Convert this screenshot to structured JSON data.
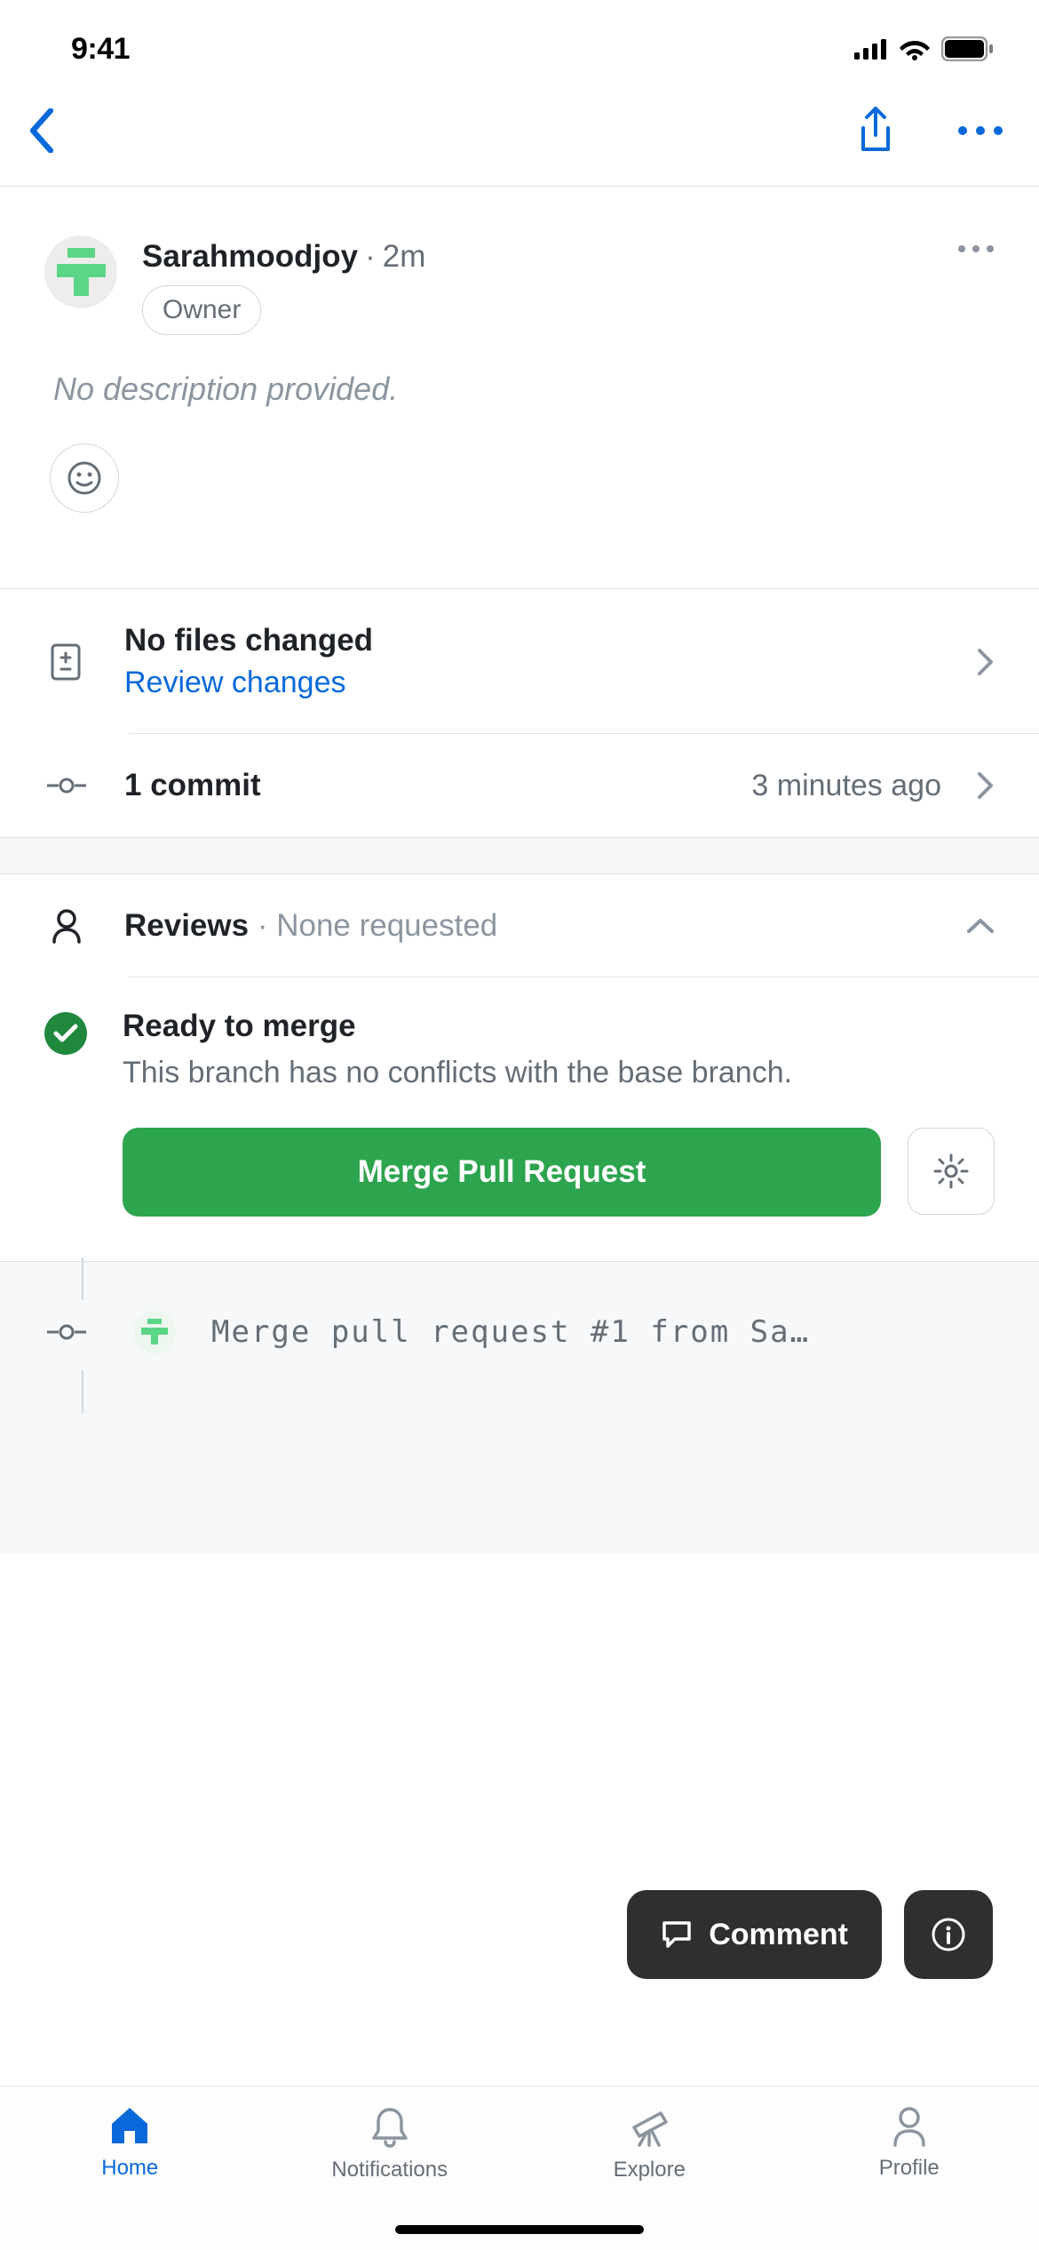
{
  "status_bar": {
    "time": "9:41"
  },
  "author": {
    "name": "Sarahmoodjoy",
    "separator": "·",
    "time_ago": "2m",
    "badge": "Owner"
  },
  "description_placeholder": "No description provided.",
  "files": {
    "title": "No files changed",
    "link": "Review changes"
  },
  "commits": {
    "count_label": "1 commit",
    "time": "3 minutes ago"
  },
  "reviews": {
    "label": "Reviews",
    "separator": " · ",
    "status": "None requested"
  },
  "merge": {
    "title": "Ready to merge",
    "description": "This branch has no conflicts with the base branch.",
    "button": "Merge Pull Request"
  },
  "commit_log": {
    "message": "Merge pull request #1 from Sa…"
  },
  "floating": {
    "comment": "Comment"
  },
  "tabs": {
    "home": "Home",
    "notifications": "Notifications",
    "explore": "Explore",
    "profile": "Profile"
  },
  "colors": {
    "blue": "#0969da",
    "green": "#2da44e",
    "check_green": "#1f883d",
    "text": "#1f2328",
    "muted": "#656d76",
    "light_muted": "#8c959f",
    "border": "#e1e4e8"
  }
}
